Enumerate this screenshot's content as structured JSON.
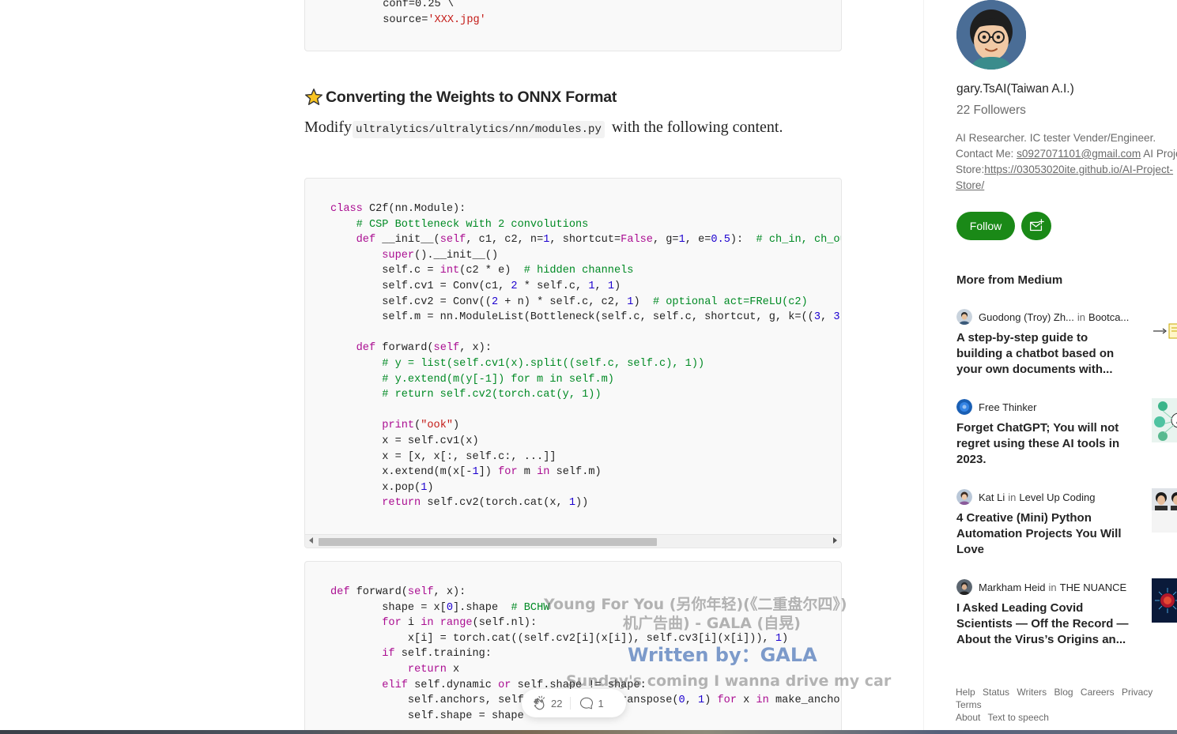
{
  "article": {
    "code_top_lines": [
      "        conf=0.25 \\",
      "        source='XXX.jpg'"
    ],
    "heading": "Converting the Weights to ONNX Format",
    "para_before": "Modify",
    "para_code": "ultralytics/ultralytics/nn/modules.py",
    "para_after": " with the following content."
  },
  "overlay_lyrics": {
    "line1": "Young For You (另你年轻)(《二重盘尔四》)",
    "line2": "机广告曲) - GALA (自晃)",
    "line3": "Written by：GALA",
    "line4": "Sunday's coming I wanna drive my car"
  },
  "clap_bar": {
    "claps": "22",
    "responses": "1"
  },
  "sidebar": {
    "author_name": "gary.TsAI(Taiwan A.I.)",
    "followers": "22 Followers",
    "bio_text": "AI Researcher. IC tester Vender/Engineer.",
    "bio_contact_label": "Contact Me: ",
    "bio_email": "s0927071101@gmail.com",
    "bio_store_label": " AI Project Store:",
    "bio_store_url": "https://03053020ite.github.io/AI-Project-Store/",
    "follow_label": "Follow",
    "more_title": "More from Medium",
    "recs": [
      {
        "author": "Guodong (Troy) Zh...",
        "in": "in",
        "pub": "Bootca...",
        "title": "A step-by-step guide to building a chatbot based on your own documents with..."
      },
      {
        "author": "Free Thinker",
        "in": "",
        "pub": "",
        "title": "Forget ChatGPT; You will not regret using these AI tools in 2023."
      },
      {
        "author": "Kat Li",
        "in": "in",
        "pub": "Level Up Coding",
        "title": "4 Creative (Mini) Python Automation Projects You Will Love"
      },
      {
        "author": "Markham Heid",
        "in": "in",
        "pub": "THE NUANCE",
        "title": "I Asked Leading Covid Scientists — Off the Record — About the Virus’s Origins an..."
      }
    ],
    "footer_links": [
      "Help",
      "Status",
      "Writers",
      "Blog",
      "Careers",
      "Privacy",
      "Terms",
      "About",
      "Text to speech"
    ]
  },
  "colors": {
    "accent": "#1a8917",
    "text": "#242424",
    "muted": "#6b6b6b"
  }
}
